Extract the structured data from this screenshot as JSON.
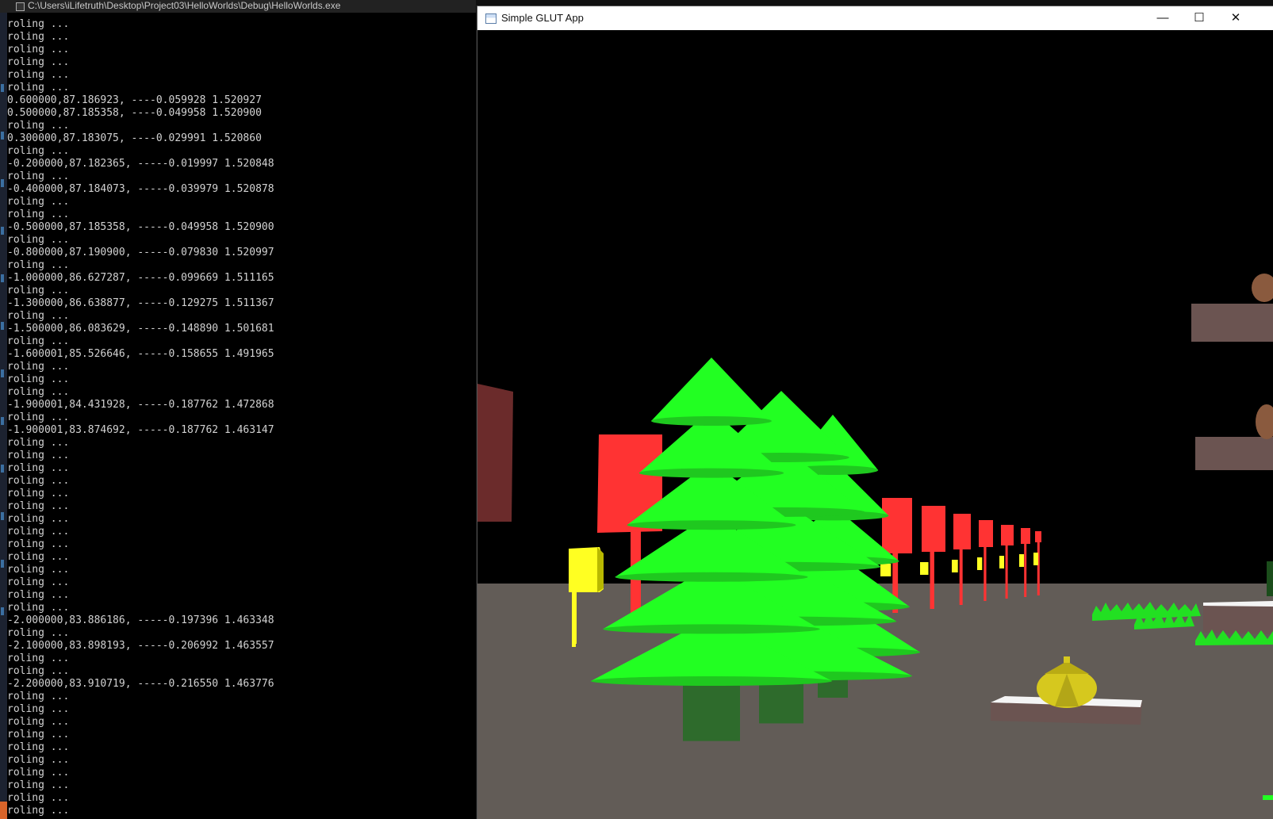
{
  "console": {
    "title": "C:\\Users\\iLifetruth\\Desktop\\Project03\\HelloWorlds\\Debug\\HelloWorlds.exe",
    "lines": [
      "roling ...",
      "roling ...",
      "roling ...",
      "roling ...",
      "roling ...",
      "roling ...",
      "0.600000,87.186923, ----0.059928 1.520927",
      "0.500000,87.185358, ----0.049958 1.520900",
      "roling ...",
      "0.300000,87.183075, ----0.029991 1.520860",
      "roling ...",
      "-0.200000,87.182365, -----0.019997 1.520848",
      "roling ...",
      "-0.400000,87.184073, -----0.039979 1.520878",
      "roling ...",
      "roling ...",
      "-0.500000,87.185358, -----0.049958 1.520900",
      "roling ...",
      "-0.800000,87.190900, -----0.079830 1.520997",
      "roling ...",
      "-1.000000,86.627287, -----0.099669 1.511165",
      "roling ...",
      "-1.300000,86.638877, -----0.129275 1.511367",
      "roling ...",
      "-1.500000,86.083629, -----0.148890 1.501681",
      "roling ...",
      "-1.600001,85.526646, -----0.158655 1.491965",
      "roling ...",
      "roling ...",
      "roling ...",
      "-1.900001,84.431928, -----0.187762 1.472868",
      "roling ...",
      "-1.900001,83.874692, -----0.187762 1.463147",
      "roling ...",
      "roling ...",
      "roling ...",
      "roling ...",
      "roling ...",
      "roling ...",
      "roling ...",
      "roling ...",
      "roling ...",
      "roling ...",
      "roling ...",
      "roling ...",
      "roling ...",
      "roling ...",
      "-2.000000,83.886186, -----0.197396 1.463348",
      "roling ...",
      "-2.100000,83.898193, -----0.206992 1.463557",
      "roling ...",
      "roling ...",
      "-2.200000,83.910719, -----0.216550 1.463776",
      "roling ...",
      "roling ...",
      "roling ...",
      "roling ...",
      "roling ...",
      "roling ...",
      "roling ...",
      "roling ...",
      "roling ...",
      "roling ..."
    ]
  },
  "glut": {
    "title": "Simple GLUT App",
    "app_icon": "window-app-icon",
    "buttons": {
      "minimize": "—",
      "maximize": "☐",
      "close": "✕"
    }
  },
  "scene": {
    "colors": {
      "sky": "#000000",
      "ground": "#625c57",
      "foliage": "#22ff22",
      "trunk": "#2e6b2c",
      "sign": "#ff3333",
      "post": "#ffff22",
      "teapot": "#d6c81e"
    }
  }
}
